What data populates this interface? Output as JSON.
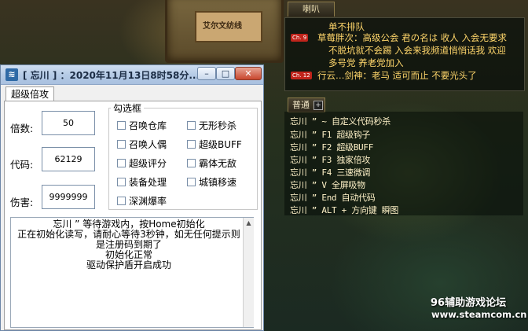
{
  "game": {
    "shop_sign": "艾尔文纺线",
    "horn_tab": "喇叭",
    "horn_lines": [
      {
        "badge": "",
        "text": "单不排队",
        "color": "#ffd66b"
      },
      {
        "badge": "Ch. 9",
        "text": "草莓胖次：高级公会 君の名は 收人 入会无要求",
        "color": "#ffd66b"
      },
      {
        "badge": "",
        "text": "不脱坑就不会踢 入会来我频道悄悄话我 欢迎",
        "color": "#ffd66b"
      },
      {
        "badge": "",
        "text": "多号党 养老党加入",
        "color": "#ffd66b"
      },
      {
        "badge": "Ch. 12",
        "text": "行云…剑神：老马  适可而止  不要光头了",
        "color": "#ffd66b"
      }
    ],
    "normal_tab": "普通",
    "normal_tab_plus": "+",
    "normal_lines": [
      "忘川 ” ~ 自定义代码秒杀",
      "忘川 ” F1  超级钩子",
      "忘川 ” F2  超级BUFF",
      "忘川 ” F3  独家倍攻",
      "忘川 ” F4  三速微调",
      "忘川 ” V   全屏吸物",
      "忘川 ” End 自动代码",
      "忘川 ” ALT + 方向键 瞬图"
    ]
  },
  "watermark": {
    "title": "96辅助游戏论坛",
    "url": "www.steamcom.cn"
  },
  "window": {
    "icon": "app-logo-icon",
    "title": "[ 忘川 ] ：2020年11月13日8时58分...",
    "tab": "超级倍攻",
    "fields": [
      {
        "label": "倍数:",
        "value": "50"
      },
      {
        "label": "代码:",
        "value": "62129"
      },
      {
        "label": "伤害:",
        "value": "9999999"
      }
    ],
    "group_title": "勾选框",
    "checkboxes_left": [
      "召唤仓库",
      "召唤人偶",
      "超级评分",
      "装备处理",
      "深渊爆率"
    ],
    "checkboxes_right": [
      "无形秒杀",
      "超级BUFF",
      "霸体无敌",
      "城镇移速"
    ],
    "log_lines": [
      "忘川 ” 等待游戏内，按Home初始化",
      "正在初始化读写，请耐心等待3秒钟，如无任何提示则",
      "是注册码到期了",
      "初始化正常",
      "驱动保护盾开启成功"
    ]
  }
}
